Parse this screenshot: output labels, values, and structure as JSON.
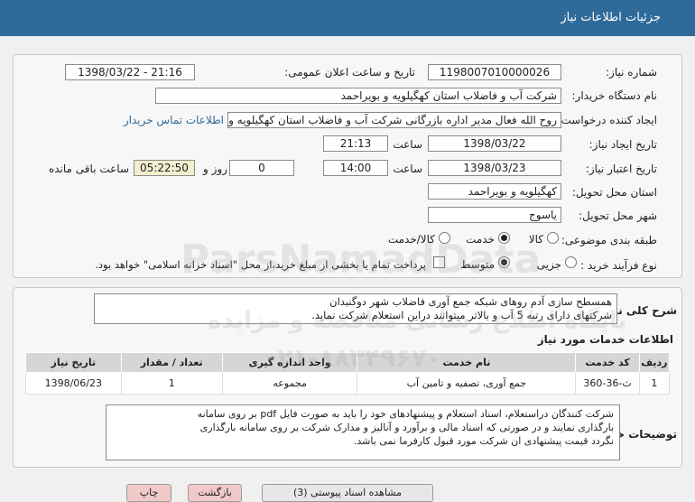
{
  "header": {
    "title": "جزئیات اطلاعات نیاز"
  },
  "form": {
    "need_number_label": "شماره نیاز:",
    "need_number": "1198007010000026",
    "announce_label": "تاریخ و ساعت اعلان عمومی:",
    "announce_value": "1398/03/22 - 21:16",
    "buyer_label": "نام دستگاه خریدار:",
    "buyer": "شرکت آب و فاضلاب استان کهگیلویه و بویراحمد",
    "creator_label": "ایجاد کننده درخواست:",
    "creator": "روح الله فعال مدیر اداره بازرگانی شرکت آب و فاضلاب استان کهگیلویه و بویراحمد",
    "contact_link": "اطلاعات تماس خریدار",
    "created_label": "تاریخ ایجاد نیاز:",
    "created_date": "1398/03/22",
    "time_label": "ساعت",
    "created_time": "21:13",
    "valid_label": "تاریخ اعتبار نیاز:",
    "valid_date": "1398/03/23",
    "valid_time": "14:00",
    "day_and": "روز و",
    "days": "0",
    "remaining": "05:22:50",
    "remaining_label": "ساعت باقی مانده",
    "province_label": "استان محل تحویل:",
    "province": "کهگیلویه و بویراحمد",
    "city_label": "شهر محل تحویل:",
    "city": "یاسوج",
    "category_label": "طبقه بندی موضوعی:",
    "category_options": [
      "کالا",
      "خدمت",
      "کالا/خدمت"
    ],
    "category_selected": "خدمت",
    "process_label": "نوع فرآیند خرید :",
    "process_options": [
      "جزیی",
      "متوسط"
    ],
    "process_selected": "متوسط",
    "treasury_note": "پرداخت تمام یا بخشی از مبلغ خرید،از محل \"اسناد خزانه اسلامی\" خواهد بود."
  },
  "description": {
    "label": "شرح کلی نیاز:",
    "line1": "همسطح سازی آدم روهای شبکه جمع آوری فاضلاب شهر دوگنبدان",
    "line2": "شرکتهای دارای رتبه 5 آب و بالاتر میتوانند دراین استعلام شرکت نماید."
  },
  "services": {
    "heading": "اطلاعات خدمات مورد نیاز",
    "columns": [
      "ردیف",
      "کد خدمت",
      "نام خدمت",
      "واحد اندازه گیری",
      "تعداد / مقدار",
      "تاریخ نیاز"
    ],
    "rows": [
      [
        "1",
        "ث-36-360",
        "جمع آوری، تصفیه و تامین آب",
        "مجموعه",
        "1",
        "1398/06/23"
      ]
    ]
  },
  "buyer_notes": {
    "label": "توضیحات خریدار:",
    "line1": "شرکت کنندگان دراستعلام، اسناد استعلام و پیشنهادهای خود را باید به صورت فایل pdf بر روی سامانه",
    "line2": "بارگذاری نمایند و در صورتی که اسناد مالی و برآورد و آنالیز و مدارک شرکت بر روی سامانه بارگذاری",
    "line3": "نگردد قیمت پیشنهادی ان شرکت مورد قبول کارفرما نمی باشد."
  },
  "bottom_bar": {
    "btn1": "مشاهده اسناد پیوستی (3)",
    "btn2": "بازگشت",
    "btn3": "چاپ"
  },
  "watermark": {
    "text1": "ParsNamadData",
    "text2": "پایگاه اطلاع رسانی مناقصه و مزایده",
    "text3": "۰۲۱-۸۸۳۴۹۶۷۰"
  }
}
